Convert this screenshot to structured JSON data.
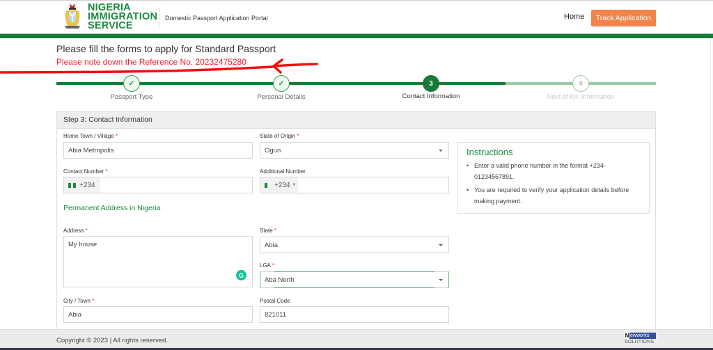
{
  "header": {
    "logo_lines": [
      "NIGERIA",
      "IMMIGRATION",
      "SERVICE"
    ],
    "portal_name": "Domestic Passport Application Portal",
    "nav": {
      "home": "Home",
      "track": "Track Application"
    }
  },
  "colors": {
    "brand_green": "#1a8a3c",
    "dark_green": "#187a38",
    "accent_orange": "#f0844a",
    "reference_red": "#e8232b"
  },
  "page": {
    "title": "Please fill the forms to apply for Standard Passport",
    "reference_note": "Please note down the Reference No. 20232475280"
  },
  "stepper": {
    "current_step": 3,
    "steps": [
      {
        "number": "1",
        "label": "Passport Type",
        "status": "completed",
        "icon": "check-icon"
      },
      {
        "number": "2",
        "label": "Personal Details",
        "status": "completed",
        "icon": "check-icon"
      },
      {
        "number": "3",
        "label": "Contact Information",
        "status": "active"
      },
      {
        "number": "4",
        "label": "Next of Kin Information",
        "status": "pending"
      }
    ],
    "check_glyph": "✓"
  },
  "form": {
    "card_title": "Step 3: Contact Information",
    "required_mark": "*",
    "fields": {
      "home_town": {
        "label": "Home Town / Village",
        "value": "Abia Metropolis",
        "required": true
      },
      "state_of_origin": {
        "label": "State of Origin",
        "value": "Ogun",
        "required": true
      },
      "contact_number": {
        "label": "Contact Number",
        "prefix": "+234",
        "value": "",
        "required": true
      },
      "additional_number": {
        "label": "Additional Number",
        "prefix": "+234",
        "value": "",
        "required": false
      },
      "address": {
        "label": "Address",
        "value": "My house",
        "required": true
      },
      "state": {
        "label": "State",
        "value": "Abia",
        "required": true
      },
      "lga": {
        "label": "LGA",
        "value": "Aba North",
        "required": true
      },
      "city": {
        "label": "City / Town",
        "value": "Abia",
        "required": true
      },
      "postal_code": {
        "label": "Postal Code",
        "value": "821011",
        "required": false
      }
    },
    "section_permanent_address": "Permanent Address in Nigeria",
    "grammarly_glyph": "G"
  },
  "instructions": {
    "title": "Instructions",
    "items": [
      "Enter a valid phone number in the format +234-01234567891.",
      "You are required to verify your application details before making payment."
    ]
  },
  "footer": {
    "copyright": "Copyright © 2023 | All rights reserved.",
    "vendor_n": "N",
    "vendor_rest": "ewworks",
    "vendor_sub": "SOLUTIONS"
  }
}
